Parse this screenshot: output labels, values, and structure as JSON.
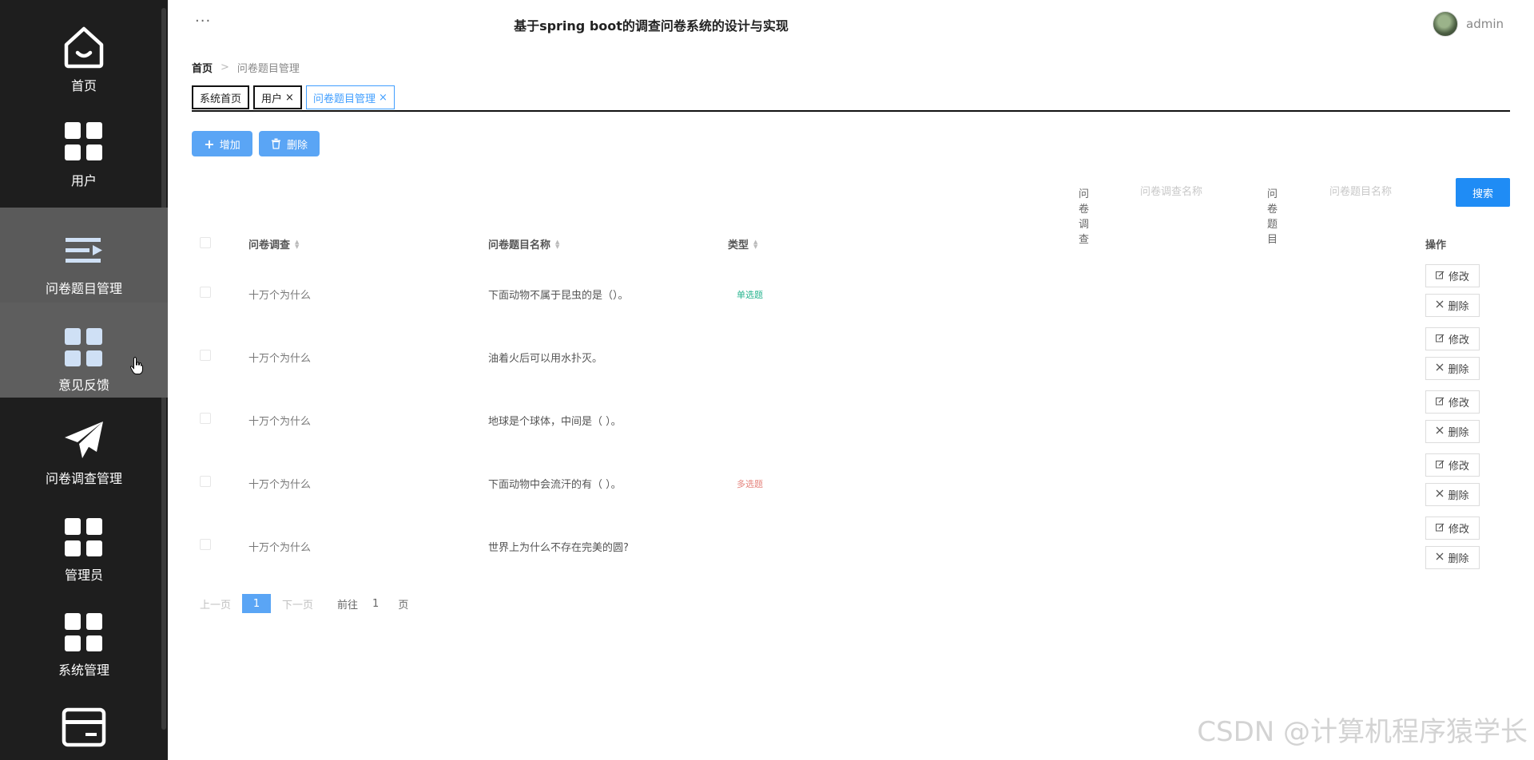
{
  "sidebar": {
    "items": [
      {
        "label": "首页",
        "icon": "home-icon"
      },
      {
        "label": "用户",
        "icon": "grid-icon"
      },
      {
        "label": "问卷题目管理",
        "icon": "list-icon"
      },
      {
        "label": "意见反馈",
        "icon": "grid-icon"
      },
      {
        "label": "问卷调查管理",
        "icon": "paper-plane-icon"
      },
      {
        "label": "管理员",
        "icon": "grid-icon"
      },
      {
        "label": "系统管理",
        "icon": "grid-icon"
      },
      {
        "label": "",
        "icon": "card-icon"
      }
    ]
  },
  "header": {
    "dots": "···",
    "title": "基于spring boot的调查问卷系统的设计与实现",
    "user": "admin"
  },
  "breadcrumb": {
    "home": "首页",
    "separator": ">",
    "current": "问卷题目管理"
  },
  "tabs": [
    {
      "label": "系统首页",
      "closable": false
    },
    {
      "label": "用户",
      "closable": true
    },
    {
      "label": "问卷题目管理",
      "closable": true
    }
  ],
  "tab_close": "×",
  "toolbar": {
    "add_icon": "+",
    "add_label": "增加",
    "delete_label": "删除"
  },
  "search": {
    "survey_label": "问卷调查",
    "survey_placeholder": "问卷调查名称",
    "question_label": "问卷题目",
    "question_placeholder": "问卷题目名称",
    "button": "搜索"
  },
  "table": {
    "columns": {
      "survey": "问卷调查",
      "question": "问卷题目名称",
      "type": "类型",
      "actions": "操作"
    },
    "rows": [
      {
        "survey": "十万个为什么",
        "question": "下面动物不属于昆虫的是（）。",
        "type": "单选题",
        "type_kind": "single"
      },
      {
        "survey": "十万个为什么",
        "question": "油着火后可以用水扑灭。",
        "type": "",
        "type_kind": ""
      },
      {
        "survey": "十万个为什么",
        "question": "地球是个球体，中间是（ ）。",
        "type": "",
        "type_kind": ""
      },
      {
        "survey": "十万个为什么",
        "question": "下面动物中会流汗的有（ ）。",
        "type": "多选题",
        "type_kind": "multi"
      },
      {
        "survey": "十万个为什么",
        "question": "世界上为什么不存在完美的圆?",
        "type": "",
        "type_kind": ""
      }
    ],
    "edit_label": "修改",
    "delete_label": "删除"
  },
  "pagination": {
    "prev": "上一页",
    "current": "1",
    "next": "下一页",
    "goto": "前往",
    "page_input": "1",
    "unit": "页"
  },
  "watermark": "CSDN @计算机程序猿学长",
  "colors": {
    "sidebar_bg": "#1e1e1e",
    "primary": "#1f8cf5",
    "primary_light": "#5aa5f5",
    "tag_single": "#28b48f",
    "tag_multi": "#e5837c"
  }
}
